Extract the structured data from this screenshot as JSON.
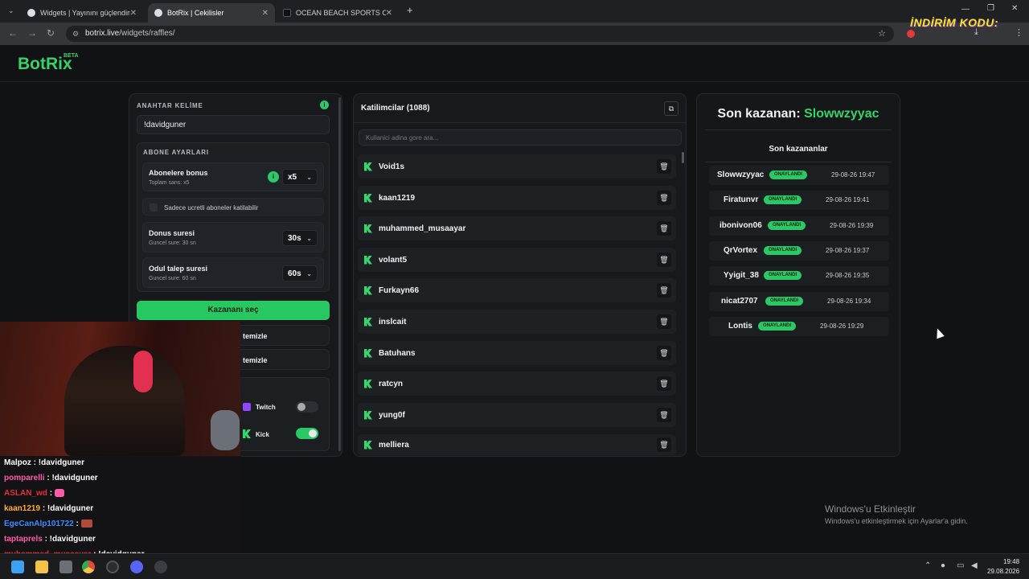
{
  "browser": {
    "tabs": [
      {
        "title": "Widgets | Yayınını güçlendirmek",
        "active": false
      },
      {
        "title": "BotRix | Cekilisler",
        "active": true
      },
      {
        "title": "OCEAN BEACH SPORTS COLLEC",
        "active": false
      }
    ],
    "url_host": "botrix.live",
    "url_path": "/widgets/raffles/",
    "promo": "İNDİRİM KODU:"
  },
  "app": {
    "logo": "BotRix",
    "beta": "BETA"
  },
  "settings": {
    "keyword_label": "ANAHTAR KELİME",
    "keyword_value": "!davidguner",
    "sub_section_label": "ABONE AYARLARI",
    "sub_bonus_title": "Abonelere bonus",
    "sub_bonus_sub": "Toplam sans: x5",
    "sub_bonus_value": "x5",
    "paid_only_label": "Sadece ucretli aboneler katilabilir",
    "turn_title": "Donus suresi",
    "turn_sub": "Guncel sure: 30 sn",
    "turn_value": "30s",
    "claim_title": "Odul talep suresi",
    "claim_sub": "Guncel sure: 60 sn",
    "claim_value": "60s",
    "pick_button": "Kazananı seç",
    "clear1": "temizle",
    "clear2": "temizle",
    "twitch_label": "Twitch",
    "kick_label": "Kick",
    "info": "i"
  },
  "participants": {
    "title": "Katilimcilar (1088)",
    "search_placeholder": "Kullanici adina gore ara...",
    "items": [
      "Void1s",
      "kaan1219",
      "muhammed_musaayar",
      "volant5",
      "Furkayn66",
      "inslcait",
      "Batuhans",
      "ratcyn",
      "yung0f",
      "melliera"
    ]
  },
  "winners": {
    "last_winner_prefix": "Son kazanan:",
    "last_winner_name": "Slowwzyyac",
    "recent_title": "Son kazananlar",
    "badge": "ONAYLANDI",
    "items": [
      {
        "name": "Slowwzyyac",
        "time": "29-08-26 19:47"
      },
      {
        "name": "Firatunvr",
        "time": "29-08-26 19:41"
      },
      {
        "name": "ibonivon06",
        "time": "29-08-26 19:39"
      },
      {
        "name": "QrVortex",
        "time": "29-08-26 19:37"
      },
      {
        "name": "Yyigit_38",
        "time": "29-08-26 19:35"
      },
      {
        "name": "nicat2707",
        "time": "29-08-26 19:34"
      },
      {
        "name": "Lontis",
        "time": "29-08-26 19:29"
      }
    ]
  },
  "chat": [
    {
      "user": "Malpoz",
      "msg": ": !davidguner",
      "color": "#ffffff"
    },
    {
      "user": "pomparelli",
      "msg": ": !davidguner",
      "color": "#ff5ca8"
    },
    {
      "user": "ASLAN_wd",
      "msg": ":",
      "color": "#e0303a"
    },
    {
      "user": "kaan1219",
      "msg": ": !davidguner",
      "color": "#ffae2b"
    },
    {
      "user": "EgeCanAlp101722",
      "msg": ":",
      "color": "#3d8bff"
    },
    {
      "user": "taptaprels",
      "msg": ": !davidguner",
      "color": "#ff5ca8"
    },
    {
      "user": "muhammed_musaayar",
      "msg": ": !davidguner",
      "color": "#e0303a"
    }
  ],
  "windows": {
    "activate_title": "Windows'u Etkinleştir",
    "activate_sub": "Windows'u etkinleştirmek için Ayarlar'a gidin.",
    "time": "19:48",
    "date": "29.08.2026"
  }
}
